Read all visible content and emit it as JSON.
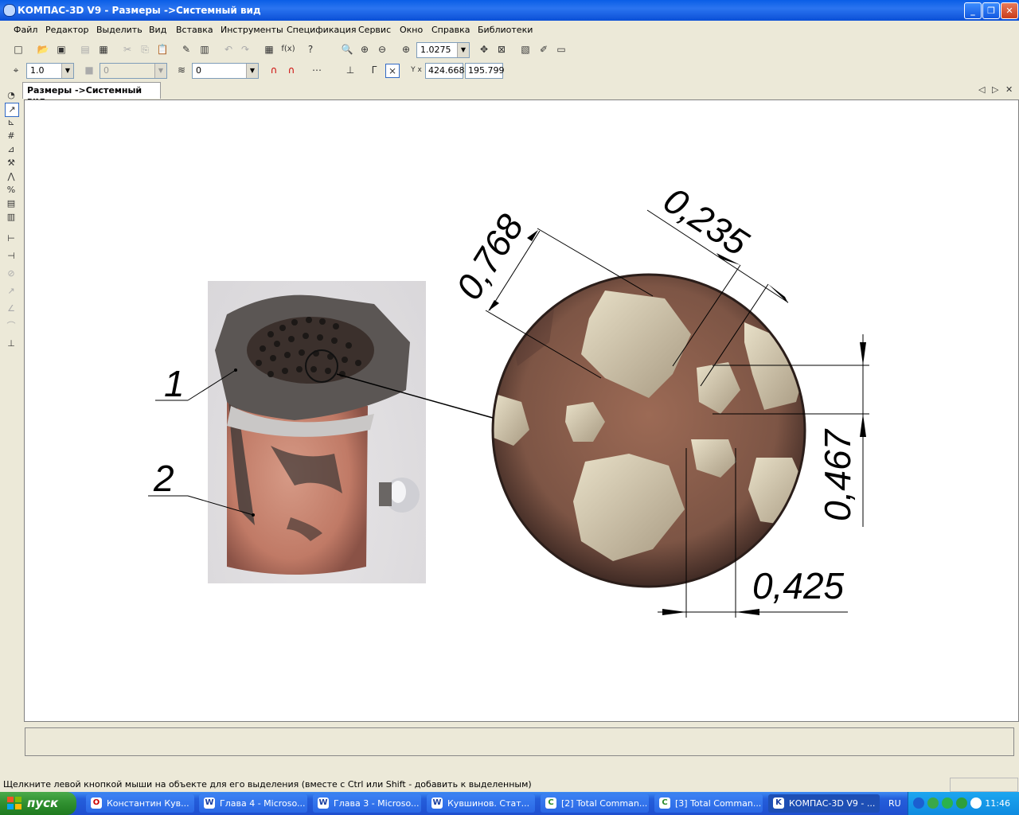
{
  "window": {
    "title": "КОМПАС-3D V9 - Размеры ->Системный вид",
    "minimize": "_",
    "restore": "❐",
    "close": "✕"
  },
  "menu": [
    "Файл",
    "Редактор",
    "Выделить",
    "Вид",
    "Вставка",
    "Инструменты",
    "Спецификация",
    "Сервис",
    "Окно",
    "Справка",
    "Библиотеки"
  ],
  "toolbar1": {
    "zoom_value": "1.0275"
  },
  "toolbar2": {
    "step_value": "1.0",
    "style_value": "0",
    "layer_value": "0",
    "coord_label": "Y x",
    "x_value": "424.668",
    "y_value": "195.799"
  },
  "doc_tab": {
    "label": "Размеры ->Системный вид"
  },
  "drawing": {
    "callouts": [
      "1",
      "2"
    ],
    "dimensions": [
      "0,768",
      "0,235",
      "0,467",
      "0,425"
    ]
  },
  "status": {
    "hint": "Щелкните левой кнопкой мыши на объекте для его выделения (вместе с Ctrl или Shift - добавить к выделенным)"
  },
  "taskbar": {
    "start_label": "пуск",
    "tasks": [
      "Константин Кув...",
      "Глава 4 - Microso...",
      "Глава 3 - Microso...",
      "Кувшинов. Стат...",
      "[2] Total Comman...",
      "[3] Total Comman...",
      "КОМПАС-3D V9 - ..."
    ],
    "language": "RU",
    "clock": "11:46"
  },
  "colors": {
    "title_blue": "#0a5ee6",
    "chrome": "#ece9d8",
    "start_green": "#2f8f2f",
    "copper": "#c8806a"
  }
}
